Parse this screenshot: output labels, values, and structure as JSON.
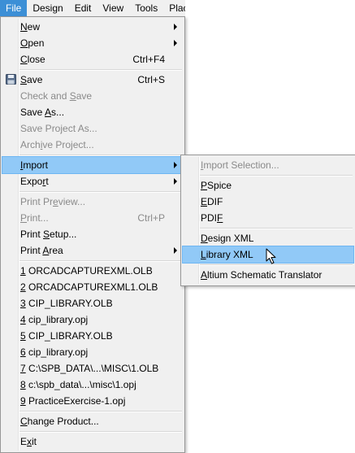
{
  "menubar": [
    "File",
    "Design",
    "Edit",
    "View",
    "Tools",
    "Plac"
  ],
  "file_menu": {
    "new": "New",
    "open": "Open",
    "close": "Close",
    "close_shortcut": "Ctrl+F4",
    "save": "Save",
    "save_shortcut": "Ctrl+S",
    "check_and_save": "Check and Save",
    "save_as": "Save As...",
    "save_project_as": "Save Project As...",
    "archive_project": "Archive Project...",
    "import": "Import",
    "export": "Export",
    "print_preview": "Print Preview...",
    "print": "Print...",
    "print_shortcut": "Ctrl+P",
    "print_setup": "Print Setup...",
    "print_area": "Print Area",
    "recent": [
      "1 ORCADCAPTUREXML.OLB",
      "2 ORCADCAPTUREXML1.OLB",
      "3 CIP_LIBRARY.OLB",
      "4 cip_library.opj",
      "5 CIP_LIBRARY.OLB",
      "6 cip_library.opj",
      "7 C:\\SPB_DATA\\...\\MISC\\1.OLB",
      "8 c:\\spb_data\\...\\misc\\1.opj",
      "9 PracticeExercise-1.opj"
    ],
    "change_product": "Change Product...",
    "exit": "Exit"
  },
  "import_menu": {
    "import_selection": "Import Selection...",
    "pspice": "PSpice",
    "edif": "EDIF",
    "pdif": "PDIF",
    "design_xml": "Design XML",
    "library_xml": "Library XML",
    "altium": "Altium Schematic Translator"
  },
  "icons": {
    "save": "floppy-disk-icon",
    "submenu": "chevron-right-icon",
    "cursor": "mouse-pointer-icon"
  },
  "colors": {
    "menubar_active": "#3c8fd6",
    "highlight": "#91c9f7",
    "menu_bg": "#f0f0f0",
    "disabled_text": "#8a8a8a"
  }
}
